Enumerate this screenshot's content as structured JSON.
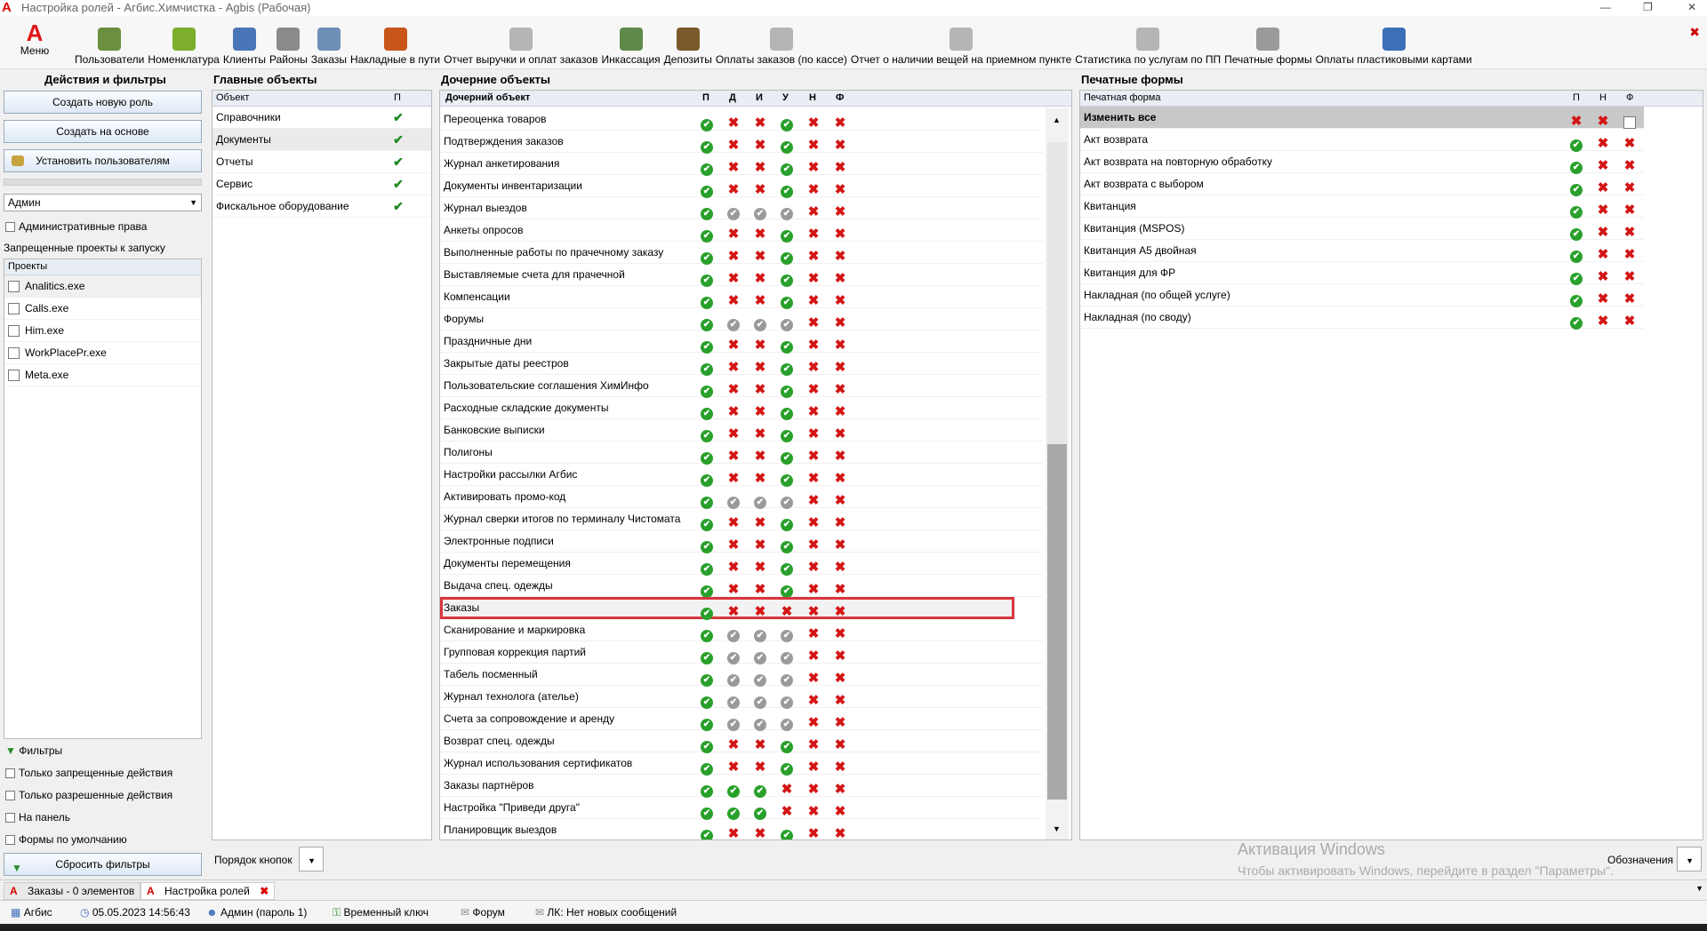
{
  "window": {
    "title": "Настройка ролей - Агбис.Химчистка - Agbis (Рабочая)"
  },
  "toolbar": {
    "menu_label": "Меню",
    "items": [
      {
        "label": "Пользователи",
        "icon": "users-icon",
        "color": "#6b8f3f"
      },
      {
        "label": "Номенклатура",
        "icon": "basket-icon",
        "color": "#7cae2c"
      },
      {
        "label": "Клиенты",
        "icon": "clients-icon",
        "color": "#4a76b8"
      },
      {
        "label": "Районы",
        "icon": "districts-icon",
        "color": "#8a8a8a"
      },
      {
        "label": "Заказы",
        "icon": "orders-icon",
        "color": "#6d8fb5"
      },
      {
        "label": "Накладные в пути",
        "icon": "truck-icon",
        "color": "#c8561a"
      },
      {
        "label": "Отчет выручки и оплат заказов",
        "icon": "report-icon",
        "color": "#b5b5b5"
      },
      {
        "label": "Инкассация",
        "icon": "cash-icon",
        "color": "#5f8a4c"
      },
      {
        "label": "Депозиты",
        "icon": "deposit-icon",
        "color": "#7a5a2a"
      },
      {
        "label": "Оплаты заказов (по кассе)",
        "icon": "report-icon",
        "color": "#b5b5b5"
      },
      {
        "label": "Отчет о наличии вещей на приемном пункте",
        "icon": "report-icon",
        "color": "#b5b5b5"
      },
      {
        "label": "Статистика по услугам по ПП",
        "icon": "report-icon",
        "color": "#b5b5b5"
      },
      {
        "label": "Печатные формы",
        "icon": "printer-icon",
        "color": "#9a9a9a"
      },
      {
        "label": "Оплаты пластиковыми картами",
        "icon": "card-icon",
        "color": "#3d6fb8"
      }
    ]
  },
  "left": {
    "title": "Действия и фильтры",
    "btn_new_role": "Создать новую роль",
    "btn_based_on": "Создать на основе",
    "btn_set_users": "Установить пользователям",
    "role": "Админ",
    "admin_rights": "Административные права",
    "forbidden_label": "Запрещенные проекты к запуску",
    "projects_header": "Проекты",
    "projects": [
      "Analitics.exe",
      "Calls.exe",
      "Him.exe",
      "WorkPlacePr.exe",
      "Meta.exe"
    ],
    "filters_label": "Фильтры",
    "f1": "Только запрещенные действия",
    "f2": "Только разрешенные действия",
    "f3": "На панель",
    "f4": "Формы по умолчанию",
    "reset": "Сбросить фильтры"
  },
  "main": {
    "title": "Главные объекты",
    "col_object": "Объект",
    "col_p": "П",
    "rows": [
      "Справочники",
      "Документы",
      "Отчеты",
      "Сервис",
      "Фискальное оборудование"
    ],
    "order_label": "Порядок кнопок"
  },
  "child": {
    "title": "Дочерние объекты",
    "col_name": "Дочерний объект",
    "cols": [
      "П",
      "Д",
      "И",
      "У",
      "Н",
      "Ф"
    ],
    "rows": [
      {
        "name": "Переоценка товаров",
        "v": "oxxoxx"
      },
      {
        "name": "Подтверждения заказов",
        "v": "oxxoxx"
      },
      {
        "name": "Журнал анкетирования",
        "v": "oxxoxx"
      },
      {
        "name": "Документы инвентаризации",
        "v": "oxxoxx"
      },
      {
        "name": "Журнал выездов",
        "v": "onnnxx"
      },
      {
        "name": "Анкеты опросов",
        "v": "oxxoxx"
      },
      {
        "name": "Выполненные работы по прачечному заказу",
        "v": "oxxoxx"
      },
      {
        "name": "Выставляемые счета для прачечной",
        "v": "oxxoxx"
      },
      {
        "name": "Компенсации",
        "v": "oxxoxx"
      },
      {
        "name": "Форумы",
        "v": "onnnxx"
      },
      {
        "name": "Праздничные дни",
        "v": "oxxoxx"
      },
      {
        "name": "Закрытые даты реестров",
        "v": "oxxoxx"
      },
      {
        "name": "Пользовательские соглашения ХимИнфо",
        "v": "oxxoxx"
      },
      {
        "name": "Расходные складские документы",
        "v": "oxxoxx"
      },
      {
        "name": "Банковские выписки",
        "v": "oxxoxx"
      },
      {
        "name": "Полигоны",
        "v": "oxxoxx"
      },
      {
        "name": "Настройки рассылки Агбис",
        "v": "oxxoxx"
      },
      {
        "name": "Активировать промо-код",
        "v": "onnnxx"
      },
      {
        "name": "Журнал сверки итогов по терминалу Чистомата",
        "v": "oxxoxx"
      },
      {
        "name": "Электронные подписи",
        "v": "oxxoxx"
      },
      {
        "name": "Документы перемещения",
        "v": "oxxoxx"
      },
      {
        "name": "Выдача спец. одежды",
        "v": "oxxoxx"
      },
      {
        "name": "Заказы",
        "v": "oxxxxx"
      },
      {
        "name": "Сканирование и маркировка",
        "v": "onnnxx"
      },
      {
        "name": "Групповая коррекция партий",
        "v": "onnnxx"
      },
      {
        "name": "Табель посменный",
        "v": "onnnxx"
      },
      {
        "name": "Журнал технолога (ателье)",
        "v": "onnnxx"
      },
      {
        "name": "Счета за сопровождение и аренду",
        "v": "onnnxx"
      },
      {
        "name": "Возврат спец. одежды",
        "v": "oxxoxx"
      },
      {
        "name": "Журнал использования сертификатов",
        "v": "oxxoxx"
      },
      {
        "name": "Заказы партнёров",
        "v": "oooxxx"
      },
      {
        "name": "Настройка \"Приведи друга\"",
        "v": "oooxxx"
      },
      {
        "name": "Планировщик выездов",
        "v": "oxxoxx"
      }
    ]
  },
  "print": {
    "title": "Печатные формы",
    "col_name": "Печатная форма",
    "cols": [
      "П",
      "Н",
      "Ф"
    ],
    "change_all": "Изменить все",
    "rows": [
      "Акт возврата",
      "Акт возврата на повторную обработку",
      "Акт возврата с выбором",
      "Квитанция",
      "Квитанция (MSPOS)",
      "Квитанция А5 двойная",
      "Квитанция для ФР",
      "Накладная (по общей услуге)",
      "Накладная (по своду)"
    ],
    "legend_label": "Обозначения"
  },
  "watermark": {
    "line1": "Активация Windows",
    "line2": "Чтобы активировать Windows, перейдите в раздел \"Параметры\"."
  },
  "tasks": {
    "t1": "Заказы - 0 элементов",
    "t2": "Настройка ролей"
  },
  "status": {
    "app": "Агбис",
    "datetime": "05.05.2023 14:56:43",
    "user": "Админ (пароль 1)",
    "key": "Временный ключ",
    "forum": "Форум",
    "lk": "ЛК: Нет новых сообщений"
  }
}
